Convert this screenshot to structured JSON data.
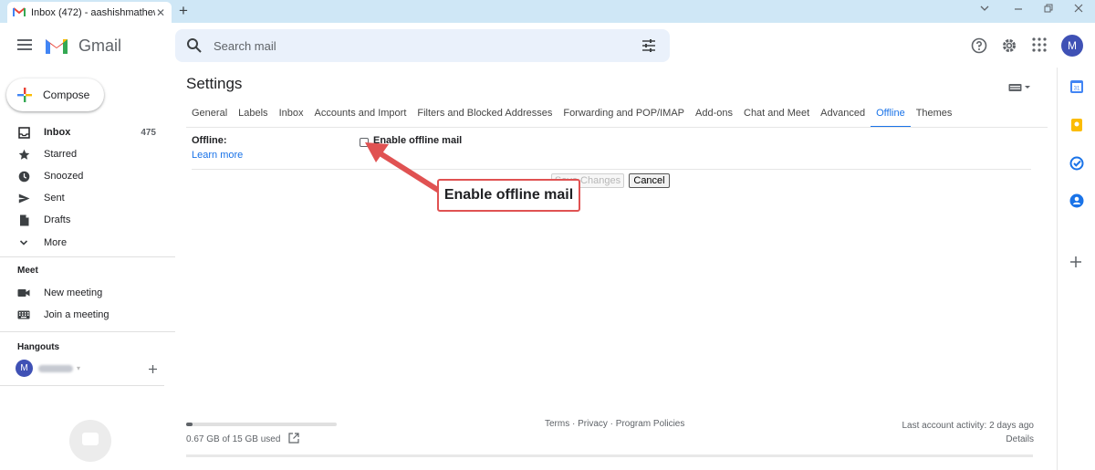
{
  "browser": {
    "tab_title": "Inbox (472) - aashishmathew03@",
    "tab_close": "✕",
    "new_tab": "+"
  },
  "header": {
    "app_name": "Gmail",
    "search_placeholder": "Search mail",
    "avatar_initial": "M"
  },
  "nav": {
    "compose": "Compose",
    "items": [
      {
        "label": "Inbox",
        "count": "475"
      },
      {
        "label": "Starred"
      },
      {
        "label": "Snoozed"
      },
      {
        "label": "Sent"
      },
      {
        "label": "Drafts"
      },
      {
        "label": "More"
      }
    ],
    "meet_heading": "Meet",
    "meet_items": [
      {
        "label": "New meeting"
      },
      {
        "label": "Join a meeting"
      }
    ],
    "hangouts_heading": "Hangouts",
    "hangouts_avatar": "M"
  },
  "settings": {
    "title": "Settings",
    "tabs": [
      "General",
      "Labels",
      "Inbox",
      "Accounts and Import",
      "Filters and Blocked Addresses",
      "Forwarding and POP/IMAP",
      "Add-ons",
      "Chat and Meet",
      "Advanced",
      "Offline",
      "Themes"
    ],
    "active_tab": "Offline",
    "offline_label": "Offline:",
    "learn_more": "Learn more",
    "enable_label": "Enable offline mail",
    "enable_checked": false,
    "save_button": "Save Changes",
    "cancel_button": "Cancel"
  },
  "annotation": {
    "callout_text": "Enable offline mail",
    "color": "#e05252"
  },
  "footer": {
    "storage_text": "0.67 GB of 15 GB used",
    "storage_used_fraction": 0.045,
    "links": "Terms · Privacy · Program Policies",
    "last_activity": "Last account activity: 2 days ago",
    "details": "Details"
  },
  "colors": {
    "accent": "#1a73e8",
    "search_bg": "#eaf1fb",
    "tabstrip_bg": "#cfe7f6",
    "avatar": "#3f51b5"
  }
}
